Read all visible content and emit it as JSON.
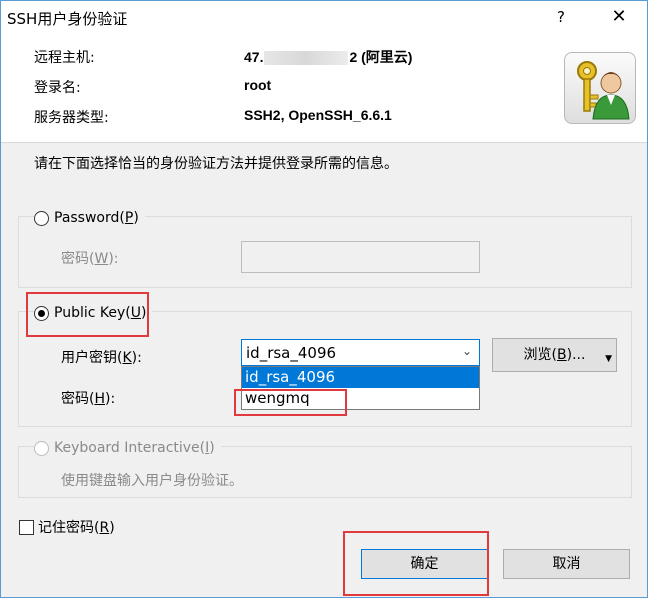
{
  "window": {
    "title": "SSH用户身份验证",
    "help_glyph": "?",
    "close_glyph": "✕"
  },
  "header": {
    "host_label": "远程主机:",
    "host_value_prefix": "47.",
    "host_value_suffix": "2 (阿里云)",
    "login_label": "登录名:",
    "login_value": "root",
    "server_type_label": "服务器类型:",
    "server_type_value": "SSH2, OpenSSH_6.6.1",
    "icon": "key-user-icon"
  },
  "instructions": "请在下面选择恰当的身份验证方法并提供登录所需的信息。",
  "password_method": {
    "label": "Password(",
    "mnemonic": "P",
    "label_end": ")",
    "selected": false,
    "password_field_label": "密码(",
    "password_field_mnemonic": "W",
    "password_field_label_end": "):"
  },
  "public_key_method": {
    "label": "Public Key(",
    "mnemonic": "U",
    "label_end": ")",
    "selected": true,
    "user_key_label": "用户密钥(",
    "user_key_mnemonic": "K",
    "user_key_label_end": "):",
    "user_key_value": "id_rsa_4096",
    "user_key_options": [
      "id_rsa_4096",
      "wengmq"
    ],
    "browse_label": "浏览(",
    "browse_mnemonic": "B",
    "browse_label_end": ")...",
    "passphrase_label": "密码(",
    "passphrase_mnemonic": "H",
    "passphrase_label_end": "):"
  },
  "keyboard_interactive": {
    "label": "Keyboard Interactive(",
    "mnemonic": "I",
    "label_end": ")",
    "enabled": false,
    "description": "使用键盘输入用户身份验证。"
  },
  "remember_password": {
    "label": "记住密码(",
    "mnemonic": "R",
    "label_end": ")",
    "checked": false
  },
  "buttons": {
    "ok": "确定",
    "cancel": "取消"
  },
  "colors": {
    "annotation": "#e0393e",
    "selection": "#0078d7",
    "border_accent": "#5b9bd5"
  }
}
